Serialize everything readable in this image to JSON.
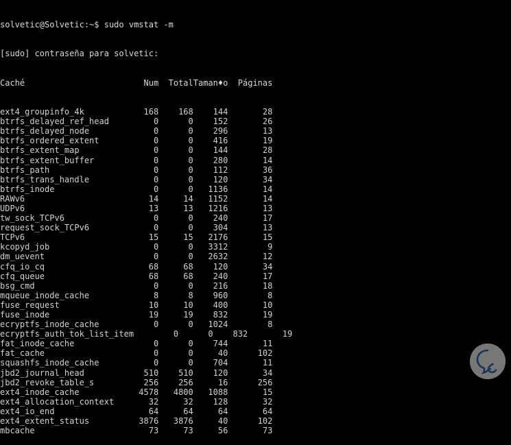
{
  "terminal": {
    "prompt_line": "solvetic@Solvetic:~$ sudo vmstat -m",
    "password_line": "[sudo] contraseña para solvetic:",
    "columns": {
      "name": "Caché",
      "num": "Num",
      "total": "Total",
      "size": "Taman♦o",
      "pages": "Páginas"
    },
    "header_raw": "Caché                      Num  Total  Taman♦o  Páginas",
    "rows": [
      {
        "name": "ext4_groupinfo_4k",
        "num": "168",
        "total": "168",
        "size": "144",
        "pages": "28",
        "shifted": false
      },
      {
        "name": "btrfs_delayed_ref_head",
        "num": "0",
        "total": "0",
        "size": "152",
        "pages": "26",
        "shifted": false
      },
      {
        "name": "btrfs_delayed_node",
        "num": "0",
        "total": "0",
        "size": "296",
        "pages": "13",
        "shifted": false
      },
      {
        "name": "btrfs_ordered_extent",
        "num": "0",
        "total": "0",
        "size": "416",
        "pages": "19",
        "shifted": false
      },
      {
        "name": "btrfs_extent_map",
        "num": "0",
        "total": "0",
        "size": "144",
        "pages": "28",
        "shifted": false
      },
      {
        "name": "btrfs_extent_buffer",
        "num": "0",
        "total": "0",
        "size": "280",
        "pages": "14",
        "shifted": false
      },
      {
        "name": "btrfs_path",
        "num": "0",
        "total": "0",
        "size": "112",
        "pages": "36",
        "shifted": false
      },
      {
        "name": "btrfs_trans_handle",
        "num": "0",
        "total": "0",
        "size": "120",
        "pages": "34",
        "shifted": false
      },
      {
        "name": "btrfs_inode",
        "num": "0",
        "total": "0",
        "size": "1136",
        "pages": "14",
        "shifted": false
      },
      {
        "name": "RAWv6",
        "num": "14",
        "total": "14",
        "size": "1152",
        "pages": "14",
        "shifted": false
      },
      {
        "name": "UDPv6",
        "num": "13",
        "total": "13",
        "size": "1216",
        "pages": "13",
        "shifted": false
      },
      {
        "name": "tw_sock_TCPv6",
        "num": "0",
        "total": "0",
        "size": "240",
        "pages": "17",
        "shifted": false
      },
      {
        "name": "request_sock_TCPv6",
        "num": "0",
        "total": "0",
        "size": "304",
        "pages": "13",
        "shifted": false
      },
      {
        "name": "TCPv6",
        "num": "15",
        "total": "15",
        "size": "2176",
        "pages": "15",
        "shifted": false
      },
      {
        "name": "kcopyd_job",
        "num": "0",
        "total": "0",
        "size": "3312",
        "pages": "9",
        "shifted": false
      },
      {
        "name": "dm_uevent",
        "num": "0",
        "total": "0",
        "size": "2632",
        "pages": "12",
        "shifted": false
      },
      {
        "name": "cfq_io_cq",
        "num": "68",
        "total": "68",
        "size": "120",
        "pages": "34",
        "shifted": false
      },
      {
        "name": "cfq_queue",
        "num": "68",
        "total": "68",
        "size": "240",
        "pages": "17",
        "shifted": false
      },
      {
        "name": "bsg_cmd",
        "num": "0",
        "total": "0",
        "size": "216",
        "pages": "18",
        "shifted": false
      },
      {
        "name": "mqueue_inode_cache",
        "num": "8",
        "total": "8",
        "size": "960",
        "pages": "8",
        "shifted": false
      },
      {
        "name": "fuse_request",
        "num": "10",
        "total": "10",
        "size": "400",
        "pages": "10",
        "shifted": false
      },
      {
        "name": "fuse_inode",
        "num": "19",
        "total": "19",
        "size": "832",
        "pages": "19",
        "shifted": false
      },
      {
        "name": "ecryptfs_inode_cache",
        "num": "0",
        "total": "0",
        "size": "1024",
        "pages": "8",
        "shifted": false
      },
      {
        "name": "ecryptfs_auth_tok_list_item",
        "num": "0",
        "total": "0",
        "size": "832",
        "pages": "19",
        "shifted": true
      },
      {
        "name": "fat_inode_cache",
        "num": "0",
        "total": "0",
        "size": "744",
        "pages": "11",
        "shifted": false
      },
      {
        "name": "fat_cache",
        "num": "0",
        "total": "0",
        "size": "40",
        "pages": "102",
        "shifted": false
      },
      {
        "name": "squashfs_inode_cache",
        "num": "0",
        "total": "0",
        "size": "704",
        "pages": "11",
        "shifted": false
      },
      {
        "name": "jbd2_journal_head",
        "num": "510",
        "total": "510",
        "size": "120",
        "pages": "34",
        "shifted": false
      },
      {
        "name": "jbd2_revoke_table_s",
        "num": "256",
        "total": "256",
        "size": "16",
        "pages": "256",
        "shifted": false
      },
      {
        "name": "ext4_inode_cache",
        "num": "4578",
        "total": "4800",
        "size": "1088",
        "pages": "15",
        "shifted": false
      },
      {
        "name": "ext4_allocation_context",
        "num": "32",
        "total": "32",
        "size": "128",
        "pages": "32",
        "shifted": false
      },
      {
        "name": "ext4_io_end",
        "num": "64",
        "total": "64",
        "size": "64",
        "pages": "64",
        "shifted": false
      },
      {
        "name": "ext4_extent_status",
        "num": "3876",
        "total": "3876",
        "size": "40",
        "pages": "102",
        "shifted": false
      },
      {
        "name": "mbcache",
        "num": "73",
        "total": "73",
        "size": "56",
        "pages": "73",
        "shifted": false
      }
    ]
  },
  "watermark": {
    "name": "solvetic-logo",
    "circle_color": "#82827f",
    "mark_color": "#1d3a63"
  },
  "colors": {
    "background": "#000000",
    "text": "#d2d2d2"
  }
}
